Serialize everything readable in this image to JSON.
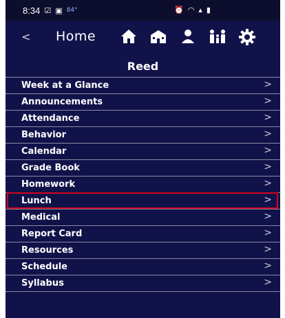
{
  "status_bar": {
    "time": "8:34",
    "temperature": "84°",
    "icons": [
      "checkbox-icon",
      "image-icon",
      "alarm-icon",
      "wifi-icon",
      "signal-icon",
      "battery-icon"
    ]
  },
  "header": {
    "back_glyph": "<",
    "title": "Home",
    "icons": [
      "home-icon",
      "school-icon",
      "student-icon",
      "family-icon",
      "settings-icon"
    ]
  },
  "school_name": "Reed",
  "menu": {
    "chevron": ">",
    "items": [
      "Week at a Glance",
      "Announcements",
      "Attendance",
      "Behavior",
      "Calendar",
      "Grade Book",
      "Homework",
      "Lunch",
      "Medical",
      "Report Card",
      "Resources",
      "Schedule",
      "Syllabus"
    ],
    "highlighted": "Lunch"
  },
  "colors": {
    "background": "#12124a",
    "statusbar": "#0d0d2d",
    "text": "#ffffff",
    "highlight": "#d0021b"
  }
}
